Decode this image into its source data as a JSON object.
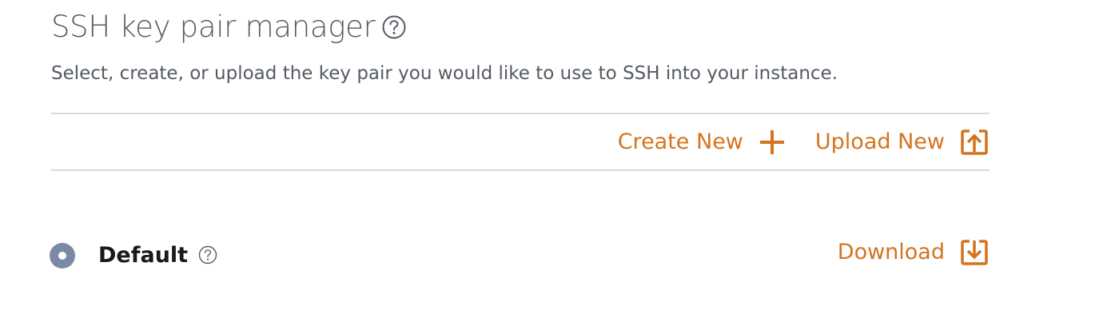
{
  "header": {
    "title": "SSH key pair manager",
    "help_icon": "question-circle-icon",
    "description": "Select, create, or upload the key pair you would like to use to SSH into your instance."
  },
  "actions": {
    "create_label": "Create New",
    "create_icon": "plus-icon",
    "upload_label": "Upload New",
    "upload_icon": "upload-icon"
  },
  "key_pairs": [
    {
      "name": "Default",
      "selected": true,
      "help_icon": "question-circle-icon",
      "download_label": "Download",
      "download_icon": "download-icon"
    }
  ],
  "colors": {
    "accent": "#d4741e",
    "text_secondary": "#545b64",
    "text_primary": "#16191f",
    "divider": "#d5dbdb",
    "radio_fill": "#7b8aa3"
  }
}
